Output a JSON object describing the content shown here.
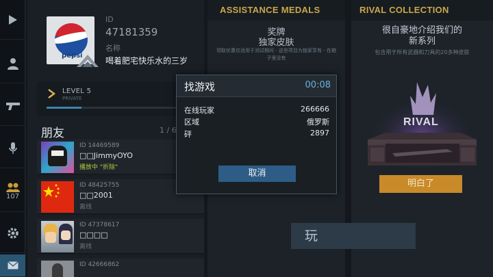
{
  "nav": {
    "friends_count": "107"
  },
  "profile": {
    "id_label": "ID",
    "id_value": "47181359",
    "name_label": "名称",
    "name_value": "喝着肥宅快乐水的三岁",
    "avatar_text": "pepsi",
    "level_label": "LEVEL 5",
    "level_sub": "PRIVATE",
    "level_progress": 0.22
  },
  "friends": {
    "title": "朋友",
    "count": "1 / 6",
    "items": [
      {
        "id": "ID 14469589",
        "name": "□□JimmyOYO",
        "status": "播放中 \"折除\"",
        "playing": true
      },
      {
        "id": "ID 48425755",
        "name": "□□2001",
        "status": "离线",
        "playing": false
      },
      {
        "id": "ID 47378617",
        "name": "□□□□",
        "status": "离线",
        "playing": false
      },
      {
        "id": "ID 42666862",
        "name": "",
        "status": "",
        "playing": false
      }
    ]
  },
  "assistance": {
    "title": "ASSISTANCE MEDALS",
    "reward_line1": "奖牌",
    "reward_line2": "独家皮肤",
    "description": "领取优惠仅适用于测试期间 - 这些项目为独家享有 - 在箱子里没有"
  },
  "rival": {
    "title": "RIVAL COLLECTION",
    "heading_line1": "很自豪地介绍我们的",
    "heading_line2": "新系列",
    "description": "包含用于所有武器和刀具的20多种皮肤",
    "logo_text": "RIVAL",
    "button": "明白了"
  },
  "play_button": "玩",
  "modal": {
    "title": "找游戏",
    "timer": "00:08",
    "stats": [
      {
        "label": "在线玩家",
        "value": "266666"
      },
      {
        "label": "区域",
        "value": "俄罗斯"
      },
      {
        "label": "砰",
        "value": "2897"
      }
    ],
    "cancel": "取消"
  },
  "colors": {
    "accent_blue": "#2d5d86",
    "timer_blue": "#69b4e0",
    "gold_title": "#c9a84a",
    "orange_button": "#c98a2a",
    "playing_status": "#b5c93b"
  }
}
